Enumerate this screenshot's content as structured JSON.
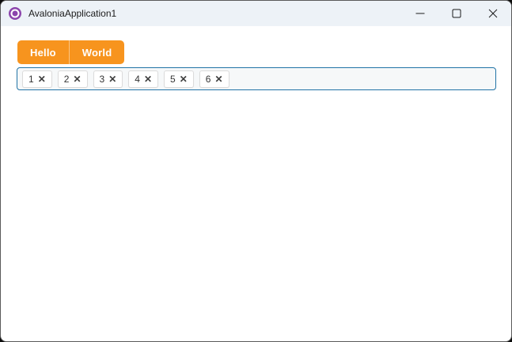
{
  "window": {
    "title": "AvaloniaApplication1"
  },
  "tabs": [
    {
      "label": "Hello"
    },
    {
      "label": "World"
    }
  ],
  "chips": [
    {
      "value": "1"
    },
    {
      "value": "2"
    },
    {
      "value": "3"
    },
    {
      "value": "4"
    },
    {
      "value": "5"
    },
    {
      "value": "6"
    }
  ],
  "icons": {
    "chip_remove": "✕"
  },
  "colors": {
    "accent_orange": "#F7941E",
    "container_border": "#2173A6",
    "logo_purple": "#8B44AC",
    "titlebar_bg": "#EDF2F7"
  }
}
